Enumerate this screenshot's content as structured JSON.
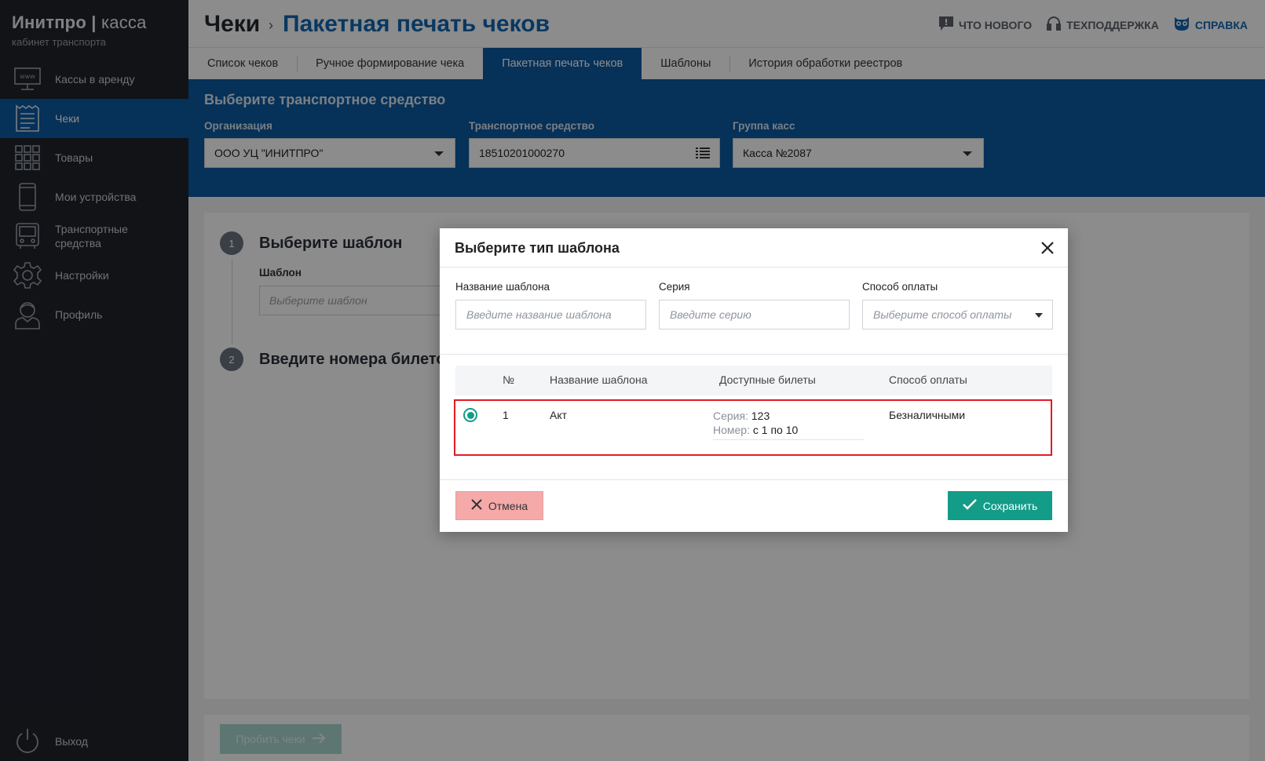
{
  "brand": {
    "name": "Инитпро",
    "product": "касса",
    "subtitle": "кабинет транспорта"
  },
  "sidebar": {
    "items": [
      {
        "label": "Кассы в аренду",
        "icon": "www-monitor-icon",
        "active": false
      },
      {
        "label": "Чеки",
        "icon": "receipt-icon",
        "active": true
      },
      {
        "label": "Товары",
        "icon": "grid-icon",
        "active": false
      },
      {
        "label": "Мои устройства",
        "icon": "phone-icon",
        "active": false
      },
      {
        "label": "Транспортные средства",
        "icon": "bus-icon",
        "active": false
      },
      {
        "label": "Настройки",
        "icon": "gear-icon",
        "active": false
      },
      {
        "label": "Профиль",
        "icon": "user-icon",
        "active": false
      }
    ],
    "logout_label": "Выход"
  },
  "header": {
    "breadcrumb_root": "Чеки",
    "breadcrumb_sep": "›",
    "breadcrumb_current": "Пакетная печать чеков",
    "links": {
      "news": "Что нового",
      "support": "Техподдержка",
      "help": "Справка"
    }
  },
  "tabs": [
    {
      "label": "Список чеков",
      "active": false
    },
    {
      "label": "Ручное формирование чека",
      "active": false
    },
    {
      "label": "Пакетная печать чеков",
      "active": true
    },
    {
      "label": "Шаблоны",
      "active": false
    },
    {
      "label": "История обработки реестров",
      "active": false
    }
  ],
  "vehicle_section": {
    "title": "Выберите транспортное средство",
    "organization_label": "Организация",
    "organization_value": "ООО УЦ \"ИНИТПРО\"",
    "vehicle_label": "Транспортное средство",
    "vehicle_value": "18510201000270",
    "group_label": "Группа касс",
    "group_value": "Касса №2087"
  },
  "steps": {
    "step1_num": "1",
    "step1_title": "Выберите шаблон",
    "template_label": "Шаблон",
    "template_placeholder": "Выберите шаблон",
    "step2_num": "2",
    "step2_title": "Введите номера билетов"
  },
  "print_button": "Пробить чеки",
  "modal": {
    "title": "Выберите тип шаблона",
    "filters": {
      "name_label": "Название шаблона",
      "name_placeholder": "Введите название шаблона",
      "series_label": "Серия",
      "series_placeholder": "Введите серию",
      "payment_label": "Способ оплаты",
      "payment_placeholder": "Выберите способ оплаты"
    },
    "table": {
      "columns": [
        "№",
        "Название шаблона",
        "Доступные билеты",
        "Способ оплаты"
      ],
      "rows": [
        {
          "selected": true,
          "num": "1",
          "name": "Акт",
          "series_key": "Серия:",
          "series_val": "123",
          "number_key": "Номер:",
          "number_val": "с 1 по 10",
          "payment": "Безналичными"
        }
      ]
    },
    "cancel_label": "Отмена",
    "save_label": "Сохранить"
  },
  "colors": {
    "accent_blue": "#0c5aa0",
    "sidebar_bg": "#1f232b",
    "save_green": "#139c88",
    "cancel_pink": "#f5a9a9",
    "highlight_red": "#e11b22"
  }
}
